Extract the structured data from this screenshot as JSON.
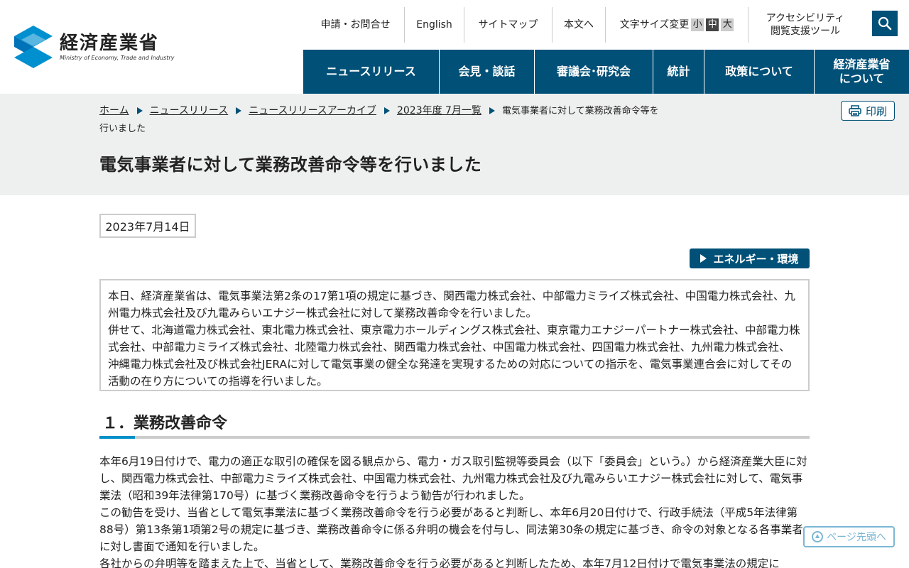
{
  "header": {
    "logo_ja": "経済産業省",
    "logo_en": "Ministry of Economy, Trade and Industry",
    "util": {
      "contact": "申請・お問合せ",
      "english": "English",
      "sitemap": "サイトマップ",
      "skip": "本文へ",
      "font_size_label": "文字サイズ変更",
      "font_small": "小",
      "font_medium": "中",
      "font_large": "大",
      "accessibility_line1": "アクセシビリティ",
      "accessibility_line2": "閲覧支援ツール"
    },
    "search_icon": "search-icon",
    "nav": [
      {
        "label": "ニュースリリース"
      },
      {
        "label": "会見・談話"
      },
      {
        "label": "審議会･研究会"
      },
      {
        "label": "統計"
      },
      {
        "label": "政策について"
      },
      {
        "label_line1": "経済産業省",
        "label_line2": "について"
      }
    ]
  },
  "breadcrumb": {
    "items": [
      "ホーム",
      "ニュースリリース",
      "ニュースリリースアーカイブ",
      "2023年度 7月一覧"
    ],
    "current": "電気事業者に対して業務改善命令等を行いました"
  },
  "print_label": "印刷",
  "page_title": "電気事業者に対して業務改善命令等を行いました",
  "date": "2023年7月14日",
  "category": "エネルギー・環境",
  "summary": {
    "p1": "本日、経済産業省は、電気事業法第2条の17第1項の規定に基づき、関西電力株式会社、中部電力ミライズ株式会社、中国電力株式会社、九州電力株式会社及び九電みらいエナジー株式会社に対して業務改善命令を行いました。",
    "p2": "併せて、北海道電力株式会社、東北電力株式会社、東京電力ホールディングス株式会社、東京電力エナジーパートナー株式会社、中部電力株式会社、中部電力ミライズ株式会社、北陸電力株式会社、関西電力株式会社、中国電力株式会社、四国電力株式会社、九州電力株式会社、沖縄電力株式会社及び株式会社JERAに対して電気事業の健全な発達を実現するための対応についての指示を、電気事業連合会に対してその活動の在り方についての指導を行いました。"
  },
  "section1": {
    "heading": "１．業務改善命令",
    "p1": "本年6月19日付けで、電力の適正な取引の確保を図る観点から、電力・ガス取引監視等委員会（以下「委員会」という。）から経済産業大臣に対し、関西電力株式会社、中部電力ミライズ株式会社、中国電力株式会社、九州電力株式会社及び九電みらいエナジー株式会社に対して、電気事業法（昭和39年法律第170号）に基づく業務改善命令を行うよう勧告が行われました。",
    "p2": "この勧告を受け、当省として電気事業法に基づく業務改善命令を行う必要があると判断し、本年6月20日付けで、行政手続法（平成5年法律第88号）第13条第1項第2号の規定に基づき、業務改善命令に係る弁明の機会を付与し、同法第30条の規定に基づき、命令の対象となる各事業者に対し書面で通知を行いました。",
    "p3": "各社からの弁明等を踏まえた上で、当省として、業務改善命令を行う必要があると判断したため、本年7月12日付けで電気事業法の規定に"
  },
  "totop_label": "ページ先頭へ",
  "colors": {
    "brand": "#005077",
    "band": "#eef0ef",
    "accent": "#0090c8"
  }
}
